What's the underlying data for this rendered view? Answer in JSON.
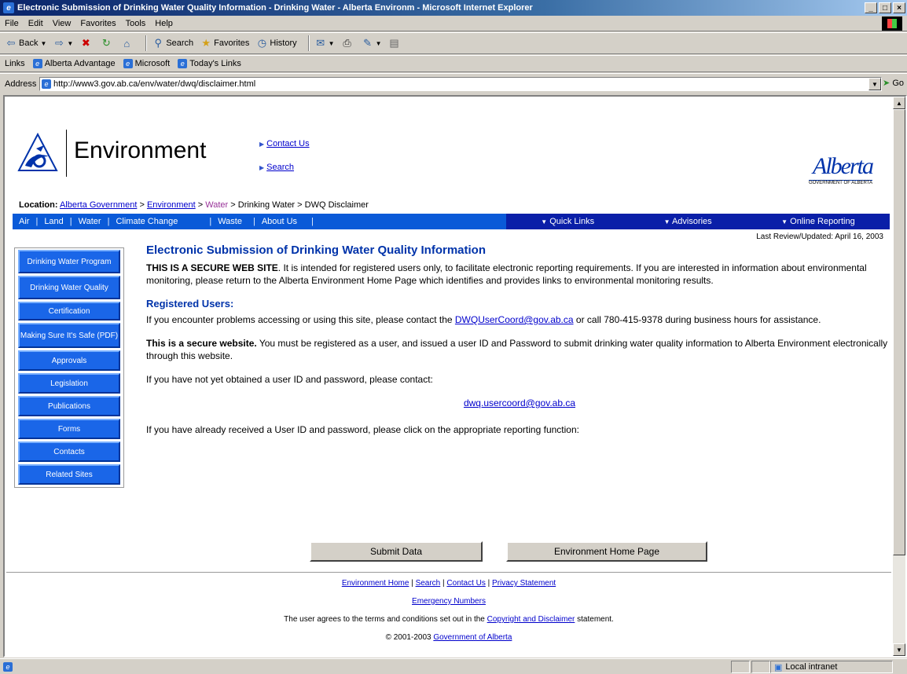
{
  "window": {
    "title": "Electronic Submission of Drinking Water Quality Information - Drinking Water - Alberta Environm - Microsoft Internet Explorer",
    "min": "_",
    "max": "□",
    "close": "×"
  },
  "menu": [
    "File",
    "Edit",
    "View",
    "Favorites",
    "Tools",
    "Help"
  ],
  "toolbar": {
    "back": "Back",
    "search": "Search",
    "favorites": "Favorites",
    "history": "History"
  },
  "links_bar": {
    "label": "Links",
    "items": [
      "Alberta Advantage",
      "Microsoft",
      "Today's Links"
    ]
  },
  "address": {
    "label": "Address",
    "url": "http://www3.gov.ab.ca/env/water/dwq/disclaimer.html",
    "go": "Go"
  },
  "header": {
    "logo_text": "Environment",
    "contact_us": "Contact Us",
    "search": "Search",
    "alberta": "Alberta",
    "alberta_sub": "GOVERNMENT OF ALBERTA"
  },
  "location": {
    "label": "Location:",
    "alberta_gov": "Alberta Government",
    "environment": "Environment",
    "water": "Water",
    "rest": "> Drinking Water > DWQ Disclaimer",
    "sep": ">"
  },
  "topnav": {
    "left": [
      "Air",
      "Land",
      "Water",
      "Climate Change",
      "Waste",
      "About Us"
    ],
    "right": [
      "Quick Links",
      "Advisories",
      "Online Reporting"
    ]
  },
  "last_review": "Last Review/Updated: April 16, 2003",
  "sidenav": [
    "Drinking Water Program",
    "Drinking Water Quality",
    "Certification",
    "Making Sure It's Safe (PDF)",
    "Approvals",
    "Legislation",
    "Publications",
    "Forms",
    "Contacts",
    "Related Sites"
  ],
  "main": {
    "title": "Electronic Submission of Drinking Water Quality Information",
    "secure_bold": "THIS IS A SECURE WEB SITE",
    "secure_text": ".  It is intended for registered users only, to facilitate electronic reporting requirements.  If you are interested in information about environmental monitoring, please return to the Alberta Environment Home Page which identifies and provides links to environmental monitoring results.",
    "registered_heading": "Registered Users:",
    "problems_text_1": "If you encounter problems accessing or using this site, please contact the ",
    "problems_link": "DWQUserCoord@gov.ab.ca",
    "problems_text_2": " or call 780-415-9378 during business hours for assistance.",
    "secure2_bold": "This is a secure website.",
    "secure2_text": "  You must be registered as a user, and issued a user ID and Password to submit drinking water quality information to Alberta Environment electronically through this website.",
    "not_obtained": "If you have not yet obtained a user ID and password, please contact:",
    "contact_email": "dwq.usercoord@gov.ab.ca",
    "already": "If you have already received a User ID and password, please click on the appropriate reporting function:",
    "submit_btn": "Submit Data",
    "home_btn": "Environment Home Page"
  },
  "footer": {
    "env_home": "Environment Home",
    "search": "Search",
    "contact": "Contact Us",
    "privacy": "Privacy Statement",
    "sep": " | ",
    "emergency": "Emergency Numbers",
    "terms_1": "The user agrees to the terms and conditions set out in the ",
    "terms_link": "Copyright and Disclaimer",
    "terms_2": " statement.",
    "copyright_1": "© 2001-2003 ",
    "copyright_link": "Government of Alberta"
  },
  "status": {
    "zone": "Local intranet"
  }
}
